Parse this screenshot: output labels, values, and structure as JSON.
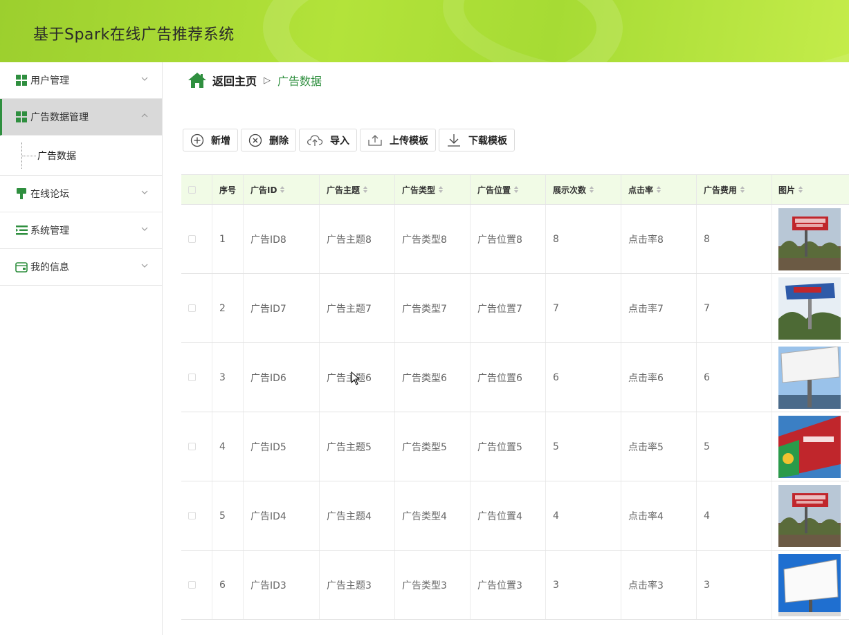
{
  "app": {
    "title": "基于Spark在线广告推荐系统"
  },
  "sidebar": {
    "items": [
      {
        "label": "用户管理",
        "icon": "grid-icon",
        "expanded": false
      },
      {
        "label": "广告数据管理",
        "icon": "grid-icon",
        "expanded": true,
        "active": true,
        "children": [
          {
            "label": "广告数据"
          }
        ]
      },
      {
        "label": "在线论坛",
        "icon": "pin-icon",
        "expanded": false
      },
      {
        "label": "系统管理",
        "icon": "list-icon",
        "expanded": false
      },
      {
        "label": "我的信息",
        "icon": "card-icon",
        "expanded": false
      }
    ]
  },
  "breadcrumb": {
    "home": "返回主页",
    "separator": "▷",
    "current": "广告数据"
  },
  "toolbar": {
    "add": "新增",
    "delete": "删除",
    "import": "导入",
    "upload_template": "上传模板",
    "download_template": "下载模板"
  },
  "table": {
    "headers": [
      "序号",
      "广告ID",
      "广告主题",
      "广告类型",
      "广告位置",
      "展示次数",
      "点击率",
      "广告费用",
      "图片"
    ],
    "rows": [
      {
        "idx": "1",
        "ad_id": "广告ID8",
        "topic": "广告主题8",
        "type": "广告类型8",
        "position": "广告位置8",
        "views": "8",
        "ctr": "点击率8",
        "cost": "8",
        "image": "billboard-red-banner"
      },
      {
        "idx": "2",
        "ad_id": "广告ID7",
        "topic": "广告主题7",
        "type": "广告类型7",
        "position": "广告位置7",
        "views": "7",
        "ctr": "点击率7",
        "cost": "7",
        "image": "billboard-blue-banner"
      },
      {
        "idx": "3",
        "ad_id": "广告ID6",
        "topic": "广告主题6",
        "type": "广告类型6",
        "position": "广告位置6",
        "views": "6",
        "ctr": "点击率6",
        "cost": "6",
        "image": "billboard-blank"
      },
      {
        "idx": "4",
        "ad_id": "广告ID5",
        "topic": "广告主题5",
        "type": "广告类型5",
        "position": "广告位置5",
        "views": "5",
        "ctr": "点击率5",
        "cost": "5",
        "image": "billboard-colorful"
      },
      {
        "idx": "5",
        "ad_id": "广告ID4",
        "topic": "广告主题4",
        "type": "广告类型4",
        "position": "广告位置4",
        "views": "4",
        "ctr": "点击率4",
        "cost": "4",
        "image": "billboard-red-banner"
      },
      {
        "idx": "6",
        "ad_id": "广告ID3",
        "topic": "广告主题3",
        "type": "广告类型3",
        "position": "广告位置3",
        "views": "3",
        "ctr": "点击率3",
        "cost": "3",
        "image": "billboard-blank-sky"
      }
    ]
  },
  "colors": {
    "brand_green": "#2f8f3f",
    "header_green": "#a6db34",
    "table_header_bg": "#f1fbe6"
  }
}
